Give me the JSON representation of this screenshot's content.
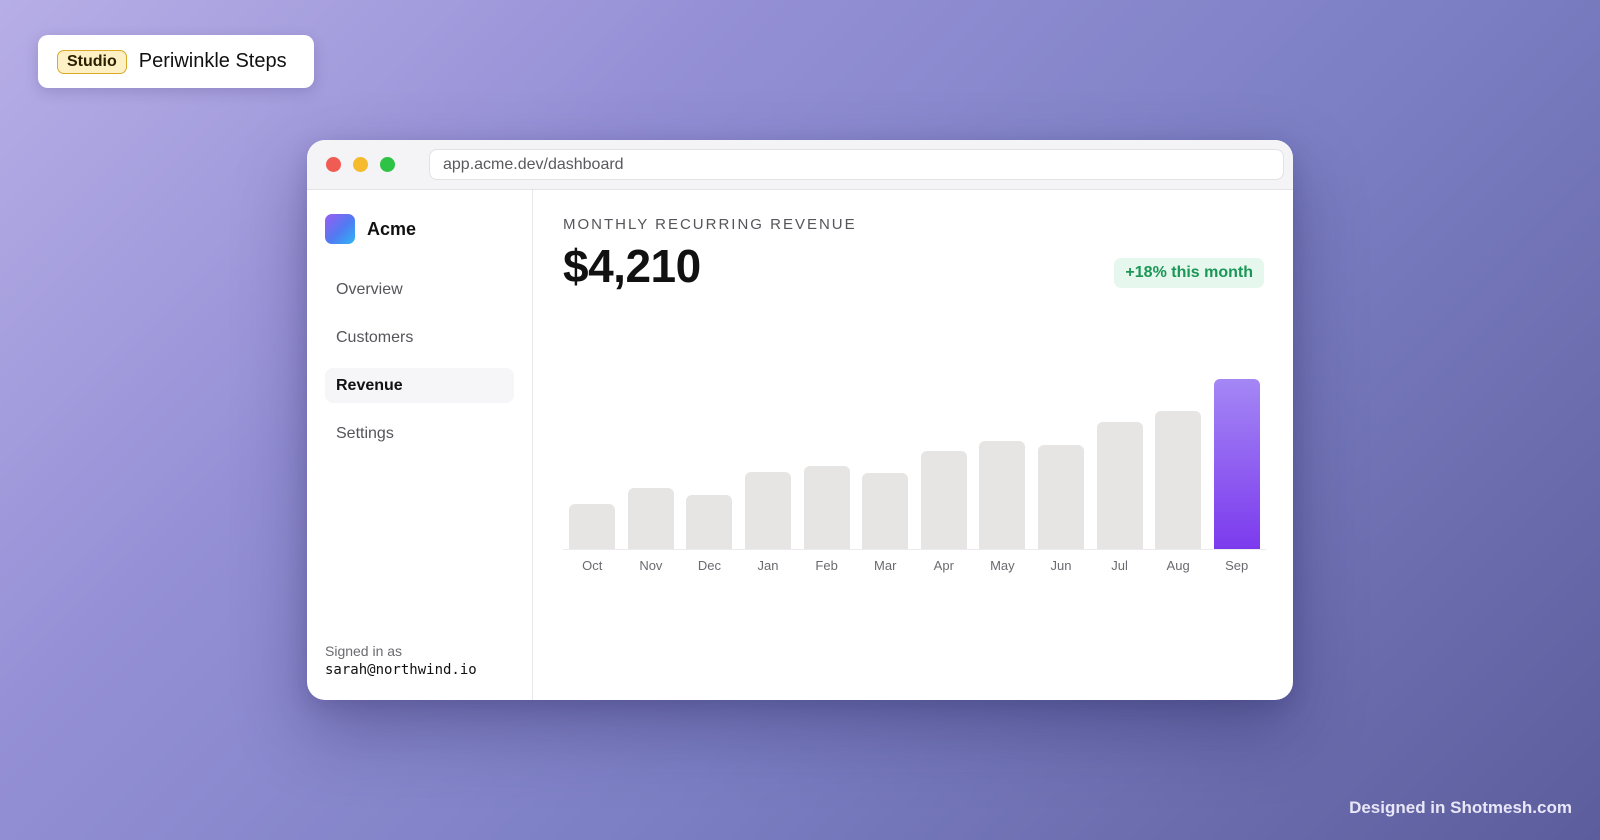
{
  "badge": {
    "tag": "Studio",
    "title": "Periwinkle Steps"
  },
  "browser": {
    "url": "app.acme.dev/dashboard"
  },
  "sidebar": {
    "brand": "Acme",
    "items": [
      {
        "label": "Overview"
      },
      {
        "label": "Customers"
      },
      {
        "label": "Revenue"
      },
      {
        "label": "Settings"
      }
    ],
    "active_item": "Revenue",
    "signed_in_label": "Signed in as",
    "signed_in_email": "sarah@northwind.io"
  },
  "main": {
    "metric_label": "MONTHLY RECURRING REVENUE",
    "metric_value": "$4,210",
    "delta": "+18% this month"
  },
  "chart_data": {
    "type": "bar",
    "categories": [
      "Oct",
      "Nov",
      "Dec",
      "Jan",
      "Feb",
      "Mar",
      "Apr",
      "May",
      "Jun",
      "Jul",
      "Aug",
      "Sep"
    ],
    "values": [
      1120,
      1500,
      1340,
      1900,
      2060,
      1870,
      2420,
      2680,
      2580,
      3150,
      3410,
      4210
    ],
    "highlight": "Sep",
    "ylim": [
      0,
      4210
    ],
    "grid": false,
    "title": "",
    "xlabel": "",
    "ylabel": ""
  },
  "colors": {
    "bar": "#e6e5e4",
    "highlight_start": "#a487f5",
    "highlight_end": "#7c3aed",
    "delta_text": "#1a9656",
    "delta_bg": "#e6f7ee"
  },
  "footer": {
    "credit": "Designed in Shotmesh.com"
  }
}
